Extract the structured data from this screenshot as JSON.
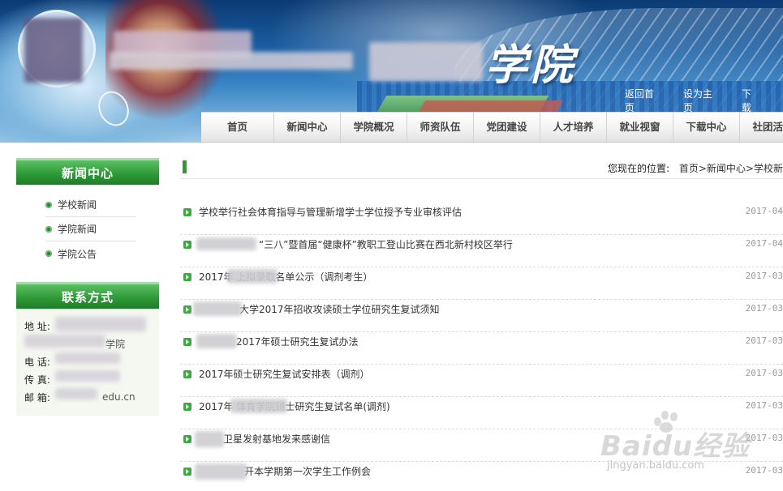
{
  "banner": {
    "title": "学院",
    "links": [
      "返回首页",
      "设为主页",
      "下载"
    ]
  },
  "nav": {
    "items": [
      "首页",
      "新闻中心",
      "学院概况",
      "师资队伍",
      "党团建设",
      "人才培养",
      "就业视窗",
      "下载中心",
      "社团活动"
    ]
  },
  "sidebar": {
    "news_title": "新闻中心",
    "news_items": [
      "学校新闻",
      "学院新闻",
      "学院公告"
    ],
    "contact_title": "联系方式",
    "contact": [
      {
        "label": "地  址:",
        "value": ""
      },
      {
        "label": "",
        "value": "学院"
      },
      {
        "label": "电  话:",
        "value": ""
      },
      {
        "label": "传  真:",
        "value": ""
      },
      {
        "label": "邮  箱:",
        "value": "edu.cn"
      }
    ]
  },
  "content": {
    "breadcrumb_label": "您现在的位置:",
    "breadcrumb": "首页>新闻中心>学校新",
    "news": [
      {
        "title": "学校举行社会体育指导与管理新增学士学位授予专业审核评估",
        "date": "2017-04"
      },
      {
        "title": "“三八”暨首届“健康杯”教职工登山比赛在西北新村校区举行",
        "date": "2017-04"
      },
      {
        "title": "2017年  上拟录取名单公示（调剂考生）",
        "date": "2017-03"
      },
      {
        "title": "大学2017年招收攻读硕士学位研究生复试须知",
        "date": "2017-03"
      },
      {
        "title": "2017年硕士研究生复试办法",
        "date": "2017-03"
      },
      {
        "title": "2017年硕士研究生复试安排表（调剂）",
        "date": "2017-03"
      },
      {
        "title": "2017年  体育学院硕士研究生复试名单(调剂)",
        "date": "2017-03"
      },
      {
        "title": "卫星发射基地发来感谢信",
        "date": "2017-03"
      },
      {
        "title": "开本学期第一次学生工作例会",
        "date": "2017-03"
      }
    ]
  },
  "watermark": {
    "text": "Baidu经验",
    "sub": "jingyan.baidu.com"
  },
  "colors": {
    "accent_green": "#2f9a38",
    "banner_blue": "#1b5fa3"
  }
}
